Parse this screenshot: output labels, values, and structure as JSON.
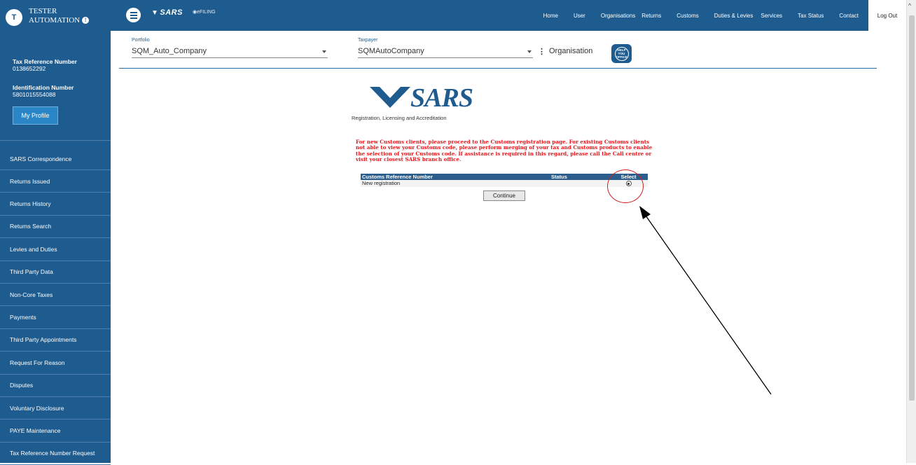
{
  "user": {
    "avatar_letter": "T",
    "name_line1": "TESTER",
    "name_line2": "AUTOMATION",
    "tax_ref_label": "Tax Reference Number",
    "tax_ref_value": "0138652292",
    "id_label": "Identification Number",
    "id_value": "5801015554088",
    "profile_button": "My Profile"
  },
  "sidebar": {
    "items": [
      {
        "label": "SARS Correspondence"
      },
      {
        "label": "Returns Issued"
      },
      {
        "label": "Returns History"
      },
      {
        "label": "Returns Search"
      },
      {
        "label": "Levies and Duties"
      },
      {
        "label": "Third Party Data"
      },
      {
        "label": "Non-Core Taxes"
      },
      {
        "label": "Payments"
      },
      {
        "label": "Third Party Appointments"
      },
      {
        "label": "Request For Reason"
      },
      {
        "label": "Disputes"
      },
      {
        "label": "Voluntary Disclosure"
      },
      {
        "label": "PAYE Maintenance"
      },
      {
        "label": "Tax Reference Number Request"
      }
    ]
  },
  "topbar": {
    "brand": "SARS",
    "efiling": "eFILING",
    "nav": [
      "Home",
      "User",
      "Organisations",
      "Returns",
      "Customs",
      "Duties & Levies",
      "Services",
      "Tax Status",
      "Contact"
    ],
    "logout": "Log Out"
  },
  "filters": {
    "portfolio_label": "Portfolio",
    "portfolio_value": "SQM_Auto_Company",
    "taxpayer_label": "Taxpayer",
    "taxpayer_value": "SQMAutoCompany",
    "org_label": "Organisation",
    "help_text": "HELP YOU OFFICE"
  },
  "main": {
    "logo_word": "SARS",
    "logo_sub": "Registration, Licensing and Accreditation",
    "warning": "For new Customs clients, please proceed to the Customs registration page. For existing Customs clients not able to view your Customs code, please perform merging of your tax and Customs products to enable the selection of your Customs code. If assistance is required in this regard, please call the Call centre or visit your closest SARS branch office.",
    "table": {
      "headers": [
        "Customs Reference Number",
        "Status",
        "Select"
      ],
      "rows": [
        {
          "ref": "New registration",
          "status": ""
        }
      ]
    },
    "continue_button": "Continue"
  },
  "colors": {
    "primary": "#1e5b8e",
    "warning": "#e8161b",
    "annotation": "#cc1f1f"
  }
}
